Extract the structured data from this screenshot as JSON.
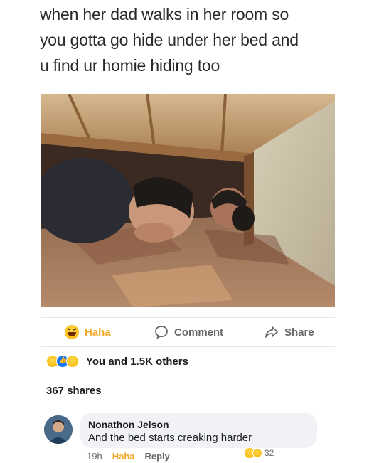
{
  "post": {
    "caption_lines": [
      "when her dad walks in her room so",
      "you gotta go hide under her bed and",
      "u find ur homie hiding too"
    ]
  },
  "actions": {
    "haha_label": "Haha",
    "comment_label": "Comment",
    "share_label": "Share"
  },
  "reactions": {
    "summary": "You and 1.5K others",
    "icons": [
      "haha-emoji",
      "like-icon",
      "sad-emoji"
    ]
  },
  "shares": {
    "text": "367 shares"
  },
  "comment": {
    "author": "Nonathon Jelson",
    "text": "And the bed starts creaking harder",
    "time": "19h",
    "haha_label": "Haha",
    "reply_label": "Reply",
    "reaction_count": "32"
  },
  "colors": {
    "haha": "#f0a826",
    "meta_gray": "#65676b",
    "bubble": "#f0f2f5"
  }
}
